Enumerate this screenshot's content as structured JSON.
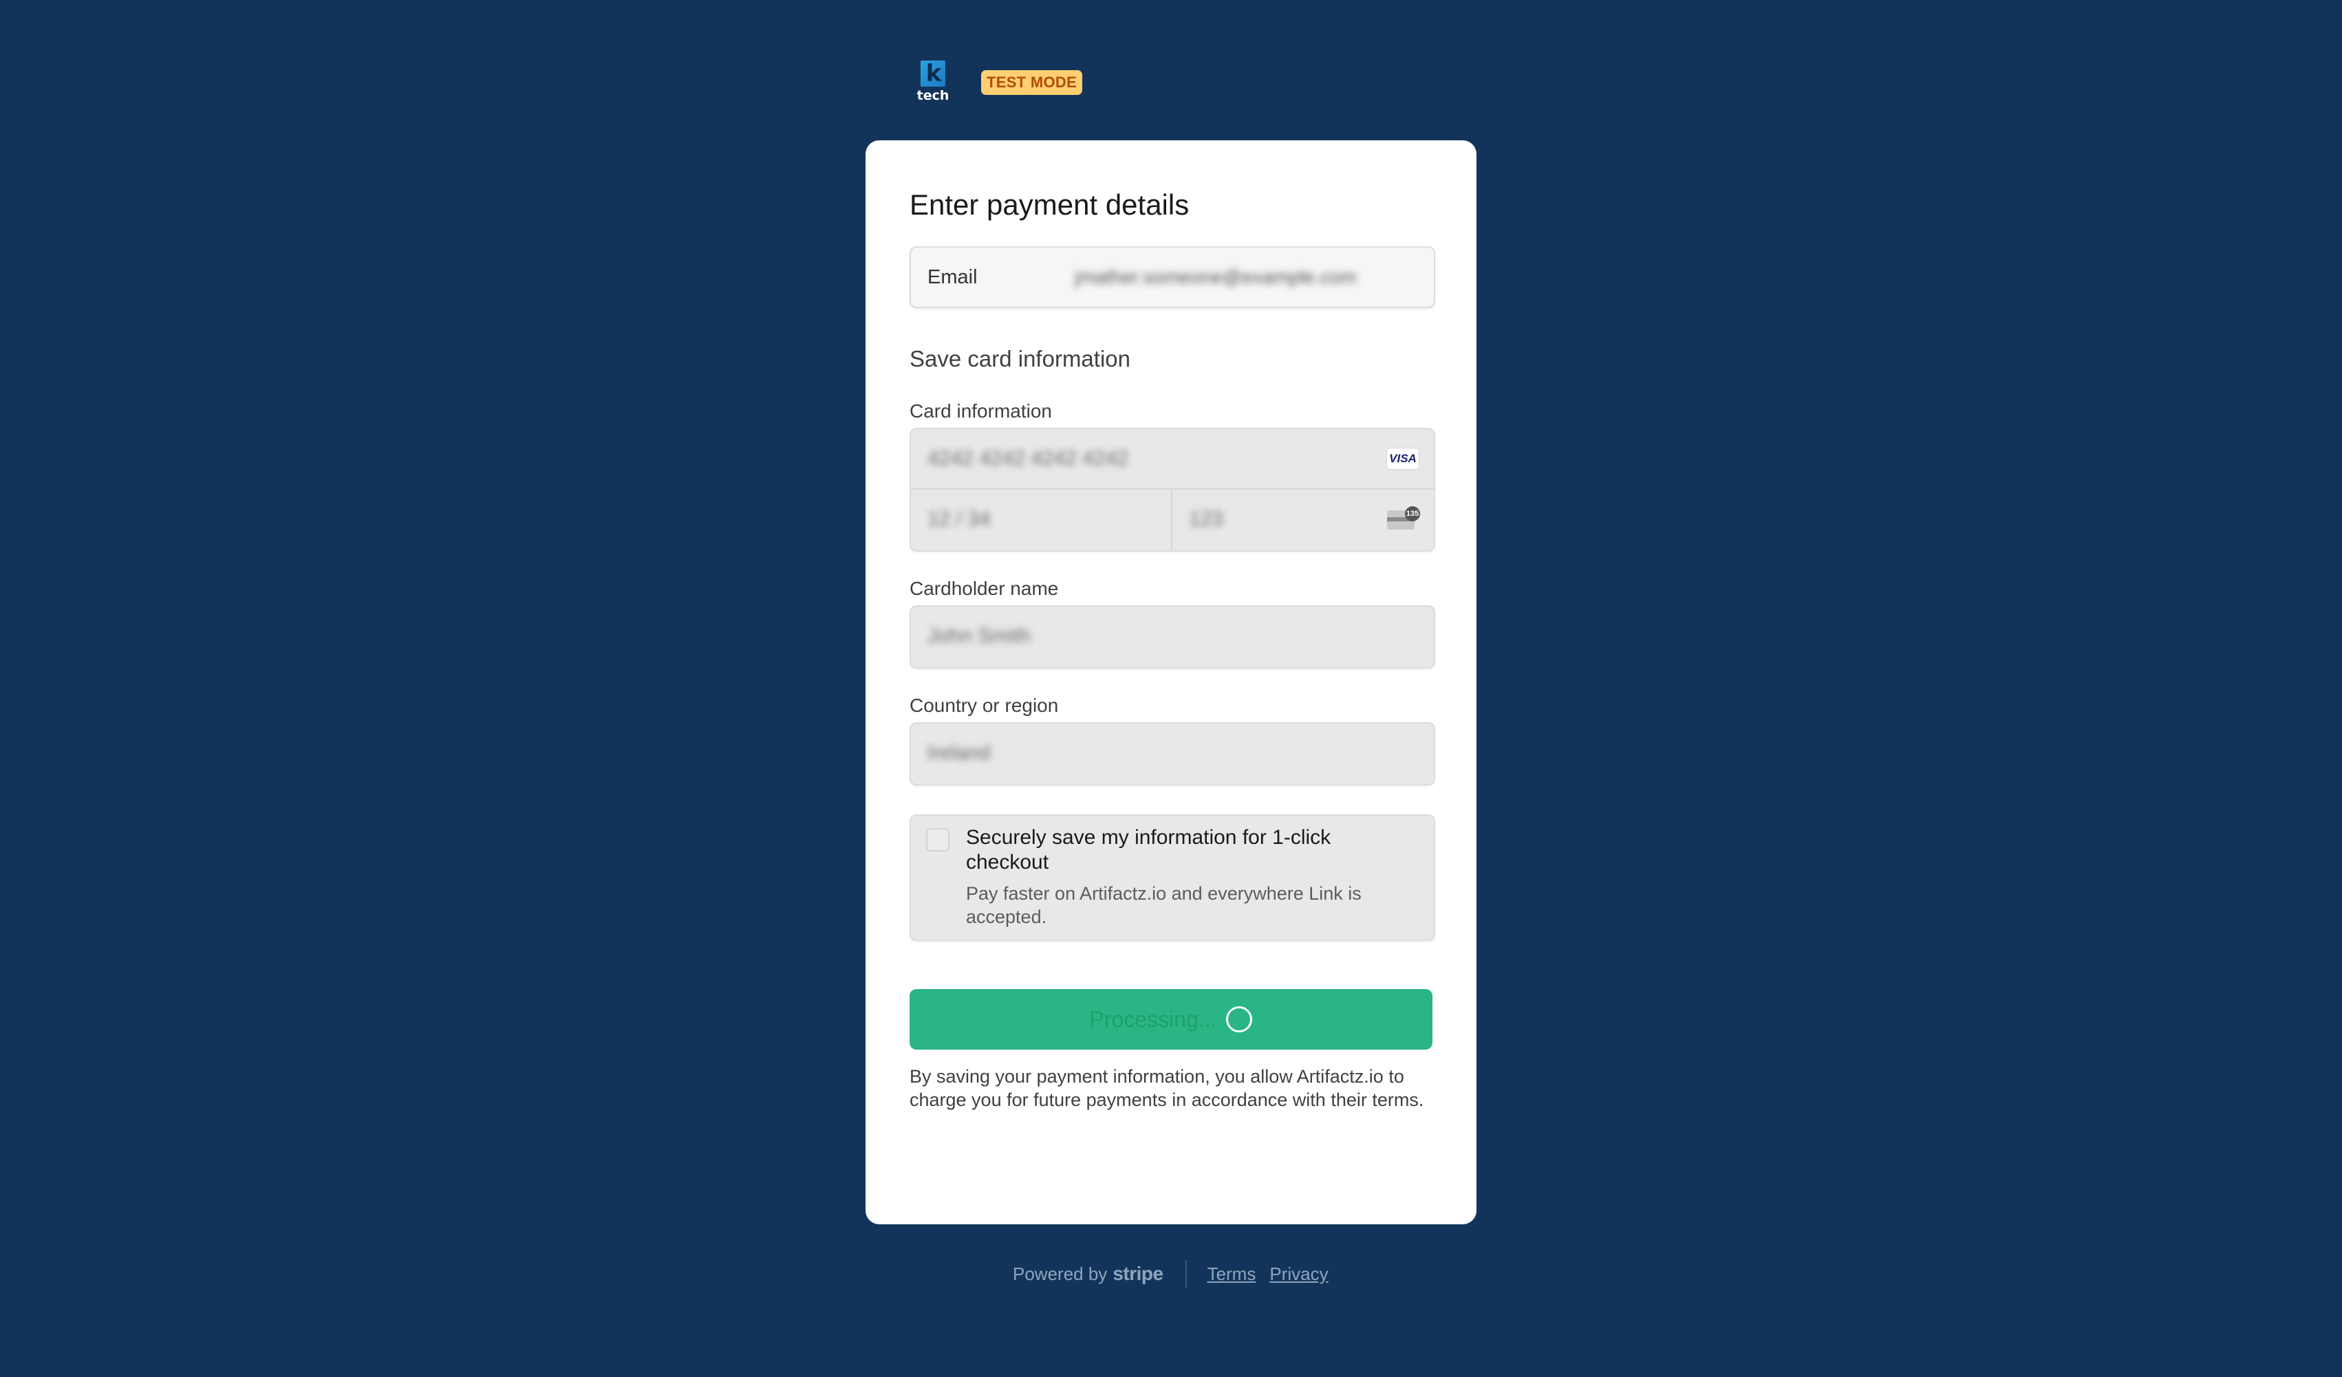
{
  "header": {
    "logo_mark": "k",
    "logo_text": "tech",
    "badge": "TEST MODE"
  },
  "form": {
    "title": "Enter payment details",
    "email": {
      "label": "Email",
      "value": "jmather.someone@example.com"
    },
    "section_title": "Save card information",
    "card_info": {
      "label": "Card information",
      "number": "4242 4242 4242 4242",
      "expiry": "12 / 34",
      "cvc": "123",
      "brand_icon": "VISA",
      "cvc_icon_text": "135"
    },
    "cardholder": {
      "label": "Cardholder name",
      "value": "John Smith"
    },
    "country": {
      "label": "Country or region",
      "value": "Ireland"
    },
    "save_checkbox": {
      "title": "Securely save my information for 1-click checkout",
      "description": "Pay faster on Artifactz.io and everywhere Link is accepted."
    },
    "submit_label": "Processing...",
    "legal": "By saving your payment information, you allow Artifactz.io to charge you for future payments in accordance with their terms."
  },
  "footer": {
    "powered_by": "Powered by",
    "brand": "stripe",
    "links": [
      "Terms",
      "Privacy"
    ]
  },
  "colors": {
    "background": "#13345a",
    "accent": "#2ab584",
    "badge_bg": "#ffcf72",
    "badge_text": "#b34c06"
  }
}
